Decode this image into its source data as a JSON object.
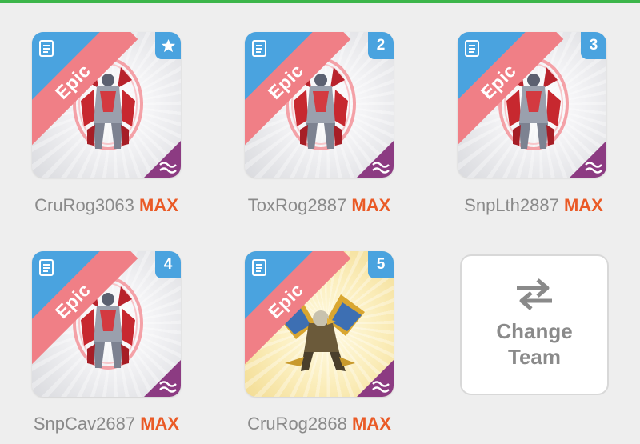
{
  "monsters": [
    {
      "name": "CruRog3063",
      "level": "MAX",
      "rarity": "Epic",
      "slot": "",
      "slot_icon": "star-icon",
      "element_icon": "wave-icon",
      "theme": "grey"
    },
    {
      "name": "ToxRog2887",
      "level": "MAX",
      "rarity": "Epic",
      "slot": "2",
      "slot_icon": "",
      "element_icon": "wave-icon",
      "theme": "grey"
    },
    {
      "name": "SnpLth2887",
      "level": "MAX",
      "rarity": "Epic",
      "slot": "3",
      "slot_icon": "",
      "element_icon": "wave-icon",
      "theme": "grey"
    },
    {
      "name": "SnpCav2687",
      "level": "MAX",
      "rarity": "Epic",
      "slot": "4",
      "slot_icon": "",
      "element_icon": "wave-icon",
      "theme": "grey"
    },
    {
      "name": "CruRog2868",
      "level": "MAX",
      "rarity": "Epic",
      "slot": "5",
      "slot_icon": "",
      "element_icon": "wave-icon",
      "theme": "gold"
    }
  ],
  "change_team": {
    "line1": "Change",
    "line2": "Team",
    "icon": "swap-arrows-icon"
  },
  "colors": {
    "rarity_ribbon": "#f07f86",
    "corner_blue": "#4aa3df",
    "corner_purple": "#8c3b82",
    "max": "#ea5a26",
    "name": "#8a8a8a",
    "top_bar": "#3cb54a"
  }
}
